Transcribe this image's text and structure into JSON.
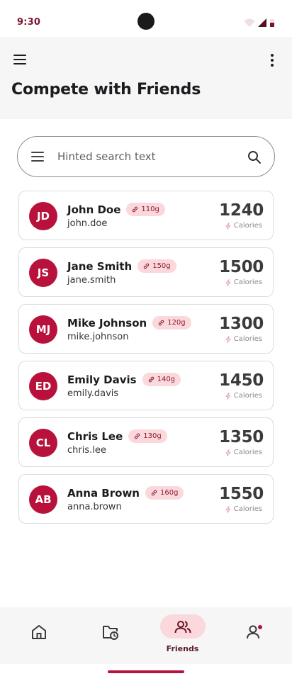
{
  "status_bar": {
    "time": "9:30"
  },
  "header": {
    "title": "Compete with Friends"
  },
  "search": {
    "placeholder": "Hinted search text",
    "value": ""
  },
  "friends": [
    {
      "initials": "JD",
      "name": "John Doe",
      "weight": "110g",
      "username": "john.doe",
      "calories": "1240",
      "calories_label": "Calories"
    },
    {
      "initials": "JS",
      "name": "Jane Smith",
      "weight": "150g",
      "username": "jane.smith",
      "calories": "1500",
      "calories_label": "Calories"
    },
    {
      "initials": "MJ",
      "name": "Mike Johnson",
      "weight": "120g",
      "username": "mike.johnson",
      "calories": "1300",
      "calories_label": "Calories"
    },
    {
      "initials": "ED",
      "name": "Emily Davis",
      "weight": "140g",
      "username": "emily.davis",
      "calories": "1450",
      "calories_label": "Calories"
    },
    {
      "initials": "CL",
      "name": "Chris Lee",
      "weight": "130g",
      "username": "chris.lee",
      "calories": "1350",
      "calories_label": "Calories"
    },
    {
      "initials": "AB",
      "name": "Anna Brown",
      "weight": "160g",
      "username": "anna.brown",
      "calories": "1550",
      "calories_label": "Calories"
    }
  ],
  "bottom_nav": {
    "items": [
      {
        "icon": "home-icon",
        "label": ""
      },
      {
        "icon": "history-icon",
        "label": ""
      },
      {
        "icon": "friends-icon",
        "label": "Friends",
        "active": true
      },
      {
        "icon": "profile-icon",
        "label": "",
        "badge": true
      }
    ]
  },
  "colors": {
    "accent": "#b8123c",
    "chip_bg": "#fbd8dc",
    "surface": "#f5f6f5"
  }
}
